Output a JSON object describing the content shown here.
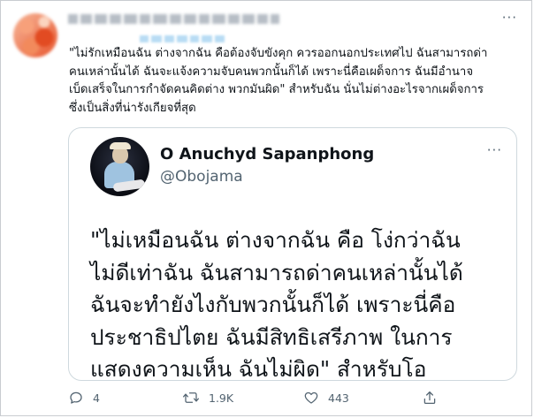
{
  "tweet": {
    "author": {
      "name_blurred": true,
      "handle_blurred": true
    },
    "more_glyph": "···",
    "text_lines": [
      "\"ไม่รักเหมือนฉัน ต่างจากฉัน คือต้องจับขังคุก ควรออกนอกประเทศไป ฉันสามารถด่า",
      "คนเหล่านั้นได้ ฉันจะแจ้งความจับคนพวกนั้นก็ได้ เพราะนี่คือเผด็จการ ฉันมีอำนาจ",
      "เบ็ดเสร็จในการกำจัดคนคิดต่าง พวกมันผิด\" สำหรับฉัน นั่นไม่ต่างอะไรจากเผด็จการ",
      "ซึ่งเป็นสิ่งที่น่ารังเกียจที่สุด"
    ],
    "quote": {
      "name": "O Anuchyd Sapanphong",
      "handle": "@Obojama",
      "more_glyph": "···",
      "text_lines": [
        "\"ไม่เหมือนฉัน ต่างจากฉัน คือ โง่กว่าฉัน",
        "ไม่ดีเท่าฉัน ฉันสามารถด่าคนเหล่านั้นได้",
        "ฉันจะทำยังไงกับพวกนั้นก็ได้ เพราะนี่คือ",
        "ประชาธิปไตย ฉันมีสิทธิเสรีภาพ ในการ",
        "แสดงความเห็น ฉันไม่ผิด\"   สำหรับโอ"
      ]
    },
    "actions": {
      "reply_count": "4",
      "retweet_count": "1.9K",
      "like_count": "443"
    }
  },
  "colors": {
    "text": "#0f1419",
    "secondary": "#536471",
    "border": "#cfd9de"
  }
}
